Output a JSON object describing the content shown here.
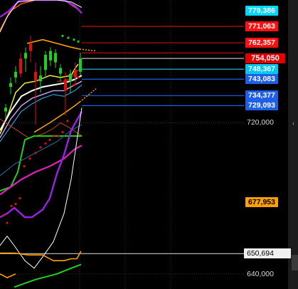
{
  "chart_data": {
    "type": "line",
    "title": "",
    "ylim": [
      632,
      785
    ],
    "grid": true,
    "axis_labels": [
      {
        "value": 720.0,
        "text": "720,000"
      },
      {
        "value": 650.694,
        "text": "650,694",
        "highlight": true
      },
      {
        "value": 640.0,
        "text": "640,000"
      }
    ],
    "current_price": {
      "value": 754.05,
      "text": "754,050",
      "color": "#e00000",
      "textColor": "#ffffff"
    },
    "price_badges": [
      {
        "value": 779.2,
        "text": "779,386",
        "color": "#00d8ff",
        "textColor": "#ffffff"
      },
      {
        "value": 771.063,
        "text": "771,063",
        "color": "#ff1010",
        "textColor": "#ffffff"
      },
      {
        "value": 762.357,
        "text": "762,357",
        "color": "#ff1010",
        "textColor": "#ffffff"
      },
      {
        "value": 748.367,
        "text": "748,367",
        "color": "#00c8f0",
        "textColor": "#ffffff"
      },
      {
        "value": 743.083,
        "text": "743,083",
        "color": "#1f5ee8",
        "textColor": "#ffffff"
      },
      {
        "value": 734.377,
        "text": "734,377",
        "color": "#1f5ee8",
        "textColor": "#ffffff"
      },
      {
        "value": 729.093,
        "text": "729,093",
        "color": "#1f5ee8",
        "textColor": "#ffffff"
      },
      {
        "value": 677.953,
        "text": "677,953",
        "color": "#ffa000",
        "textColor": "#000000"
      }
    ],
    "level_lines": [
      {
        "value": 771.063,
        "x_from": 115,
        "color": "#c81010"
      },
      {
        "value": 762.357,
        "x_from": 115,
        "color": "#c81010"
      },
      {
        "value": 757.0,
        "x_from": 115,
        "color": "#c81010"
      },
      {
        "value": 754.05,
        "x_from": 115,
        "color": "#bbbbbb"
      },
      {
        "value": 748.367,
        "x_from": 115,
        "color": "#28c8f0"
      },
      {
        "value": 743.083,
        "x_from": 115,
        "color": "#1f5ee8"
      },
      {
        "value": 734.377,
        "x_from": 115,
        "color": "#1f5ee8"
      },
      {
        "value": 729.093,
        "x_from": 115,
        "color": "#1f5ee8"
      },
      {
        "value": 650.694,
        "x_from": 0,
        "color": "#b0b0b0"
      }
    ],
    "grid_lines": {
      "horizontal": [
        720.0,
        640.0
      ],
      "vertical_x": [
        112,
        176,
        240
      ]
    },
    "candles": [
      {
        "x": 8,
        "o": 726,
        "h": 730,
        "l": 722,
        "c": 728
      },
      {
        "x": 15,
        "o": 739,
        "h": 744,
        "l": 735,
        "c": 741
      },
      {
        "x": 22,
        "o": 744,
        "h": 750,
        "l": 741,
        "c": 747
      },
      {
        "x": 29,
        "o": 754,
        "h": 757,
        "l": 744,
        "c": 746
      },
      {
        "x": 36,
        "o": 754,
        "h": 760,
        "l": 747,
        "c": 757
      },
      {
        "x": 43,
        "o": 762,
        "h": 766,
        "l": 752,
        "c": 758
      },
      {
        "x": 50,
        "o": 747,
        "h": 752,
        "l": 719,
        "c": 742
      },
      {
        "x": 57,
        "o": 742,
        "h": 750,
        "l": 736,
        "c": 745
      },
      {
        "x": 64,
        "o": 748,
        "h": 758,
        "l": 744,
        "c": 756
      },
      {
        "x": 71,
        "o": 753,
        "h": 760,
        "l": 750,
        "c": 758
      },
      {
        "x": 78,
        "o": 752,
        "h": 759,
        "l": 749,
        "c": 757
      },
      {
        "x": 85,
        "o": 746,
        "h": 751,
        "l": 742,
        "c": 749
      },
      {
        "x": 92,
        "o": 743,
        "h": 747,
        "l": 724,
        "c": 737
      },
      {
        "x": 99,
        "o": 742,
        "h": 748,
        "l": 736,
        "c": 746
      },
      {
        "x": 106,
        "o": 748,
        "h": 752,
        "l": 740,
        "c": 744
      },
      {
        "x": 113,
        "o": 747,
        "h": 757,
        "l": 745,
        "c": 754
      }
    ],
    "series": [
      {
        "color": "#ff5a00",
        "width": 1.5,
        "points": [
          [
            0,
            769
          ],
          [
            14,
            779
          ],
          [
            30,
            783
          ],
          [
            50,
            785
          ],
          [
            70,
            785
          ],
          [
            90,
            785
          ],
          [
            110,
            780
          ]
        ]
      },
      {
        "color": "#9b20e8",
        "width": 2.4,
        "points": [
          [
            0,
            776
          ],
          [
            12,
            779
          ],
          [
            28,
            785
          ],
          [
            60,
            785
          ],
          [
            90,
            785
          ],
          [
            105,
            782
          ],
          [
            115,
            778
          ]
        ]
      },
      {
        "color": "#ffffff",
        "width": 1,
        "points": [
          [
            0,
            768
          ],
          [
            10,
            776
          ],
          [
            25,
            784
          ],
          [
            50,
            785
          ],
          [
            80,
            785
          ],
          [
            100,
            784
          ],
          [
            115,
            781
          ]
        ]
      },
      {
        "color": "#ffa000",
        "width": 1.6,
        "points": [
          [
            38,
            762
          ],
          [
            60,
            764
          ],
          [
            80,
            762
          ],
          [
            100,
            760
          ],
          [
            112,
            759
          ]
        ]
      },
      {
        "color": "#ffa000",
        "width": 1.6,
        "dash": "2,2",
        "points": [
          [
            112,
            759
          ],
          [
            135,
            758
          ]
        ]
      },
      {
        "color": "#ffff30",
        "width": 1.4,
        "points": [
          [
            0,
            714
          ],
          [
            12,
            725
          ],
          [
            22,
            736
          ],
          [
            35,
            741
          ],
          [
            50,
            742
          ],
          [
            70,
            745
          ],
          [
            85,
            744
          ],
          [
            100,
            745
          ],
          [
            106,
            749
          ],
          [
            110,
            751
          ]
        ]
      },
      {
        "color": "#cc3030",
        "width": 1,
        "points": [
          [
            80,
            742
          ],
          [
            92,
            742
          ],
          [
            100,
            744
          ],
          [
            113,
            749
          ]
        ]
      },
      {
        "color": "#ffffff",
        "width": 2,
        "points": [
          [
            0,
            716
          ],
          [
            15,
            726
          ],
          [
            30,
            734
          ],
          [
            45,
            737
          ],
          [
            60,
            739
          ],
          [
            75,
            740
          ],
          [
            90,
            741
          ],
          [
            105,
            743
          ],
          [
            115,
            745
          ]
        ]
      },
      {
        "color": "#d4a5ff",
        "width": 1.4,
        "points": [
          [
            0,
            712
          ],
          [
            15,
            722
          ],
          [
            30,
            729
          ],
          [
            45,
            733
          ],
          [
            60,
            735
          ],
          [
            75,
            737
          ],
          [
            90,
            737
          ],
          [
            105,
            740
          ],
          [
            115,
            742
          ]
        ]
      },
      {
        "color": "#28b8ff",
        "width": 1,
        "points": [
          [
            0,
            710
          ],
          [
            15,
            718
          ],
          [
            30,
            726
          ],
          [
            45,
            730
          ],
          [
            60,
            733
          ],
          [
            75,
            735
          ],
          [
            90,
            734
          ],
          [
            105,
            737
          ],
          [
            115,
            740
          ]
        ]
      },
      {
        "color": "#ffa000",
        "width": 1.5,
        "points": [
          [
            48,
            715
          ],
          [
            70,
            720
          ],
          [
            90,
            725
          ],
          [
            105,
            729
          ],
          [
            112,
            731
          ]
        ]
      },
      {
        "color": "#ffa000",
        "width": 1.5,
        "dash": "2,2",
        "points": [
          [
            112,
            731
          ],
          [
            135,
            738
          ]
        ]
      },
      {
        "color": "#cc4010",
        "width": 1,
        "points": [
          [
            0,
            722
          ],
          [
            20,
            717
          ],
          [
            40,
            712
          ],
          [
            60,
            714
          ],
          [
            75,
            717
          ],
          [
            85,
            720
          ],
          [
            95,
            718
          ],
          [
            115,
            713
          ]
        ]
      },
      {
        "color": "#20d020",
        "width": 2,
        "points": [
          [
            0,
            684
          ],
          [
            15,
            686
          ],
          [
            25,
            694
          ],
          [
            35,
            711
          ],
          [
            48,
            713
          ],
          [
            60,
            713
          ],
          [
            80,
            713
          ],
          [
            115,
            713
          ]
        ]
      },
      {
        "color": "#2070a0",
        "width": 1,
        "points": [
          [
            0,
            692
          ],
          [
            20,
            698
          ],
          [
            40,
            702
          ],
          [
            60,
            706
          ],
          [
            80,
            710
          ],
          [
            100,
            716
          ],
          [
            115,
            719
          ]
        ]
      },
      {
        "color": "#e020b8",
        "width": 2.2,
        "points": [
          [
            0,
            682
          ],
          [
            15,
            686
          ],
          [
            30,
            690
          ],
          [
            50,
            694
          ],
          [
            70,
            697
          ],
          [
            90,
            701
          ],
          [
            105,
            706
          ],
          [
            115,
            708
          ]
        ]
      },
      {
        "color": "#9b20e8",
        "width": 2.4,
        "points": [
          [
            0,
            670
          ],
          [
            10,
            672
          ],
          [
            20,
            675
          ],
          [
            35,
            670
          ],
          [
            45,
            670
          ],
          [
            60,
            674
          ],
          [
            70,
            680
          ],
          [
            80,
            693
          ],
          [
            90,
            703
          ],
          [
            100,
            716
          ],
          [
            115,
            726
          ]
        ]
      },
      {
        "color": "#ffffff",
        "width": 1,
        "points": [
          [
            0,
            655
          ],
          [
            10,
            660
          ],
          [
            20,
            655
          ],
          [
            35,
            647
          ],
          [
            48,
            643
          ],
          [
            60,
            649
          ],
          [
            75,
            657
          ],
          [
            90,
            672
          ],
          [
            100,
            690
          ],
          [
            115,
            728
          ]
        ]
      },
      {
        "color": "#ffa000",
        "width": 1.6,
        "points": [
          [
            0,
            651
          ],
          [
            20,
            651
          ],
          [
            40,
            650
          ],
          [
            60,
            650
          ],
          [
            75,
            647
          ],
          [
            90,
            647
          ],
          [
            100,
            648
          ],
          [
            108,
            648
          ],
          [
            114,
            652
          ]
        ]
      },
      {
        "color": "#20d020",
        "width": 2,
        "points": [
          [
            20,
            633
          ],
          [
            50,
            637
          ],
          [
            80,
            640
          ],
          [
            100,
            643
          ],
          [
            114,
            645
          ]
        ]
      },
      {
        "color": "#ffa000",
        "width": 1.6,
        "points": [
          [
            0,
            640
          ],
          [
            10,
            638
          ],
          [
            22,
            640
          ]
        ]
      }
    ],
    "dot_groups": [
      {
        "color": "#e01010",
        "r": 1.6,
        "points": [
          [
            5,
            671
          ],
          [
            10,
            667
          ],
          [
            16,
            676
          ],
          [
            22,
            677
          ],
          [
            28,
            680
          ],
          [
            34,
            697
          ],
          [
            42,
            701
          ],
          [
            50,
            704
          ],
          [
            57,
            707
          ],
          [
            64,
            709
          ],
          [
            70,
            711
          ],
          [
            76,
            713
          ],
          [
            82,
            713
          ],
          [
            88,
            715
          ],
          [
            95,
            721
          ],
          [
            104,
            740
          ],
          [
            110,
            744
          ]
        ]
      },
      {
        "color": "#20d020",
        "r": 1.6,
        "points": [
          [
            88,
            766
          ],
          [
            96,
            765
          ],
          [
            104,
            764
          ],
          [
            110,
            763
          ]
        ]
      }
    ]
  }
}
